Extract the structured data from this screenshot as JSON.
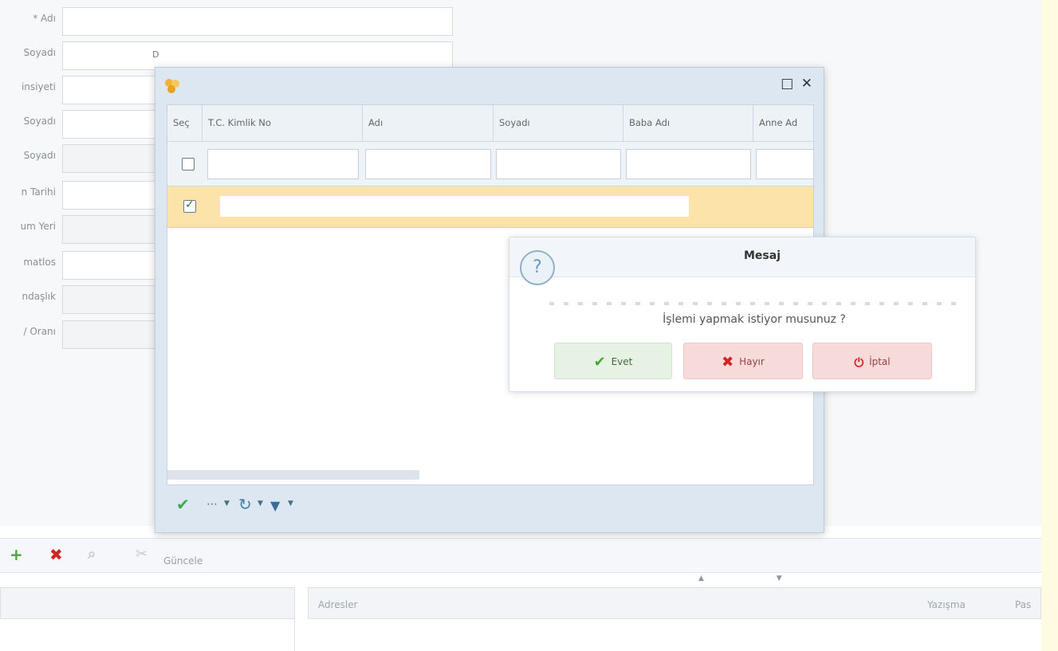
{
  "form": {
    "fields": [
      {
        "label": "* Adı",
        "value": ""
      },
      {
        "label": "Soyadı",
        "value": "D"
      },
      {
        "label": "insiyeti",
        "value": ""
      },
      {
        "label": "Soyadı",
        "value": ""
      },
      {
        "label": "Soyadı",
        "value": ""
      },
      {
        "label": "n Tarihi",
        "value": ""
      },
      {
        "label": "um Yeri",
        "value": ""
      },
      {
        "label": "matlos",
        "value": ""
      },
      {
        "label": "ndaşlık",
        "value": ""
      },
      {
        "label": "/ Oranı",
        "value": ""
      }
    ]
  },
  "bottom": {
    "toolbar": {
      "update_label": "Güncele"
    },
    "right_header": {
      "col1": "Adresler",
      "col2": "Yazışma",
      "col3": "Pas"
    },
    "sort_arrows": "▲ ▼"
  },
  "selection_window": {
    "controls": {
      "maximize": "□",
      "close": "✕"
    },
    "columns": [
      "Seç",
      "T.C. Kimlik No",
      "Adı",
      "Soyadı",
      "Baba Adı",
      "Anne Ad"
    ],
    "row_status": "checked"
  },
  "message_dialog": {
    "title": "Mesaj",
    "icon": "?",
    "text": "İşlemi yapmak istiyor musunuz ?",
    "buttons": {
      "yes": {
        "label": "Evet",
        "icon": "✔"
      },
      "no": {
        "label": "Hayır",
        "icon": "✖"
      },
      "cancel": {
        "label": "İptal",
        "icon": "⏻"
      }
    }
  },
  "colors": {
    "accent_yes": "#4aa63b",
    "accent_no": "#d32424",
    "selected_row": "#fbe3a9",
    "window_bg": "#dde7f1"
  }
}
